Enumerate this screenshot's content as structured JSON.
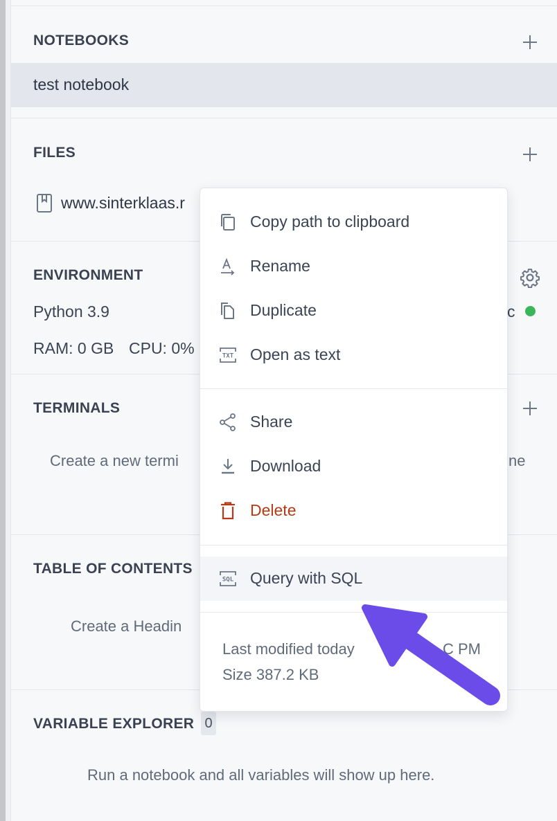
{
  "notebooks": {
    "title": "NOTEBOOKS",
    "items": [
      "test notebook"
    ]
  },
  "files": {
    "title": "FILES",
    "items": [
      "www.sinterklaas.r"
    ]
  },
  "environment": {
    "title": "ENVIRONMENT",
    "python": "Python 3.9",
    "status_fragment": "c",
    "ram": "RAM: 0 GB",
    "cpu": "CPU: 0%",
    "status_color": "#3bb55b"
  },
  "terminals": {
    "title": "TERMINALS",
    "empty_left": "Create a new termi",
    "empty_right": "ne"
  },
  "toc": {
    "title": "TABLE OF CONTENTS",
    "empty": "Create a Headin"
  },
  "variables": {
    "title": "VARIABLE EXPLORER",
    "count": "0",
    "empty": "Run a notebook and all variables will show up here."
  },
  "context_menu": {
    "items": [
      {
        "label": "Copy path to clipboard",
        "icon": "copy-icon"
      },
      {
        "label": "Rename",
        "icon": "rename-icon"
      },
      {
        "label": "Duplicate",
        "icon": "duplicate-icon"
      },
      {
        "label": "Open as text",
        "icon": "txt-icon"
      },
      {
        "label": "Share",
        "icon": "share-icon"
      },
      {
        "label": "Download",
        "icon": "download-icon"
      },
      {
        "label": "Delete",
        "icon": "trash-icon"
      },
      {
        "label": "Query with SQL",
        "icon": "sql-icon"
      }
    ],
    "last_modified": "Last modified today",
    "time_fragment": "C PM",
    "size": "Size 387.2 KB"
  },
  "colors": {
    "accent_arrow": "#6c4ce8",
    "delete": "#b73a16"
  }
}
